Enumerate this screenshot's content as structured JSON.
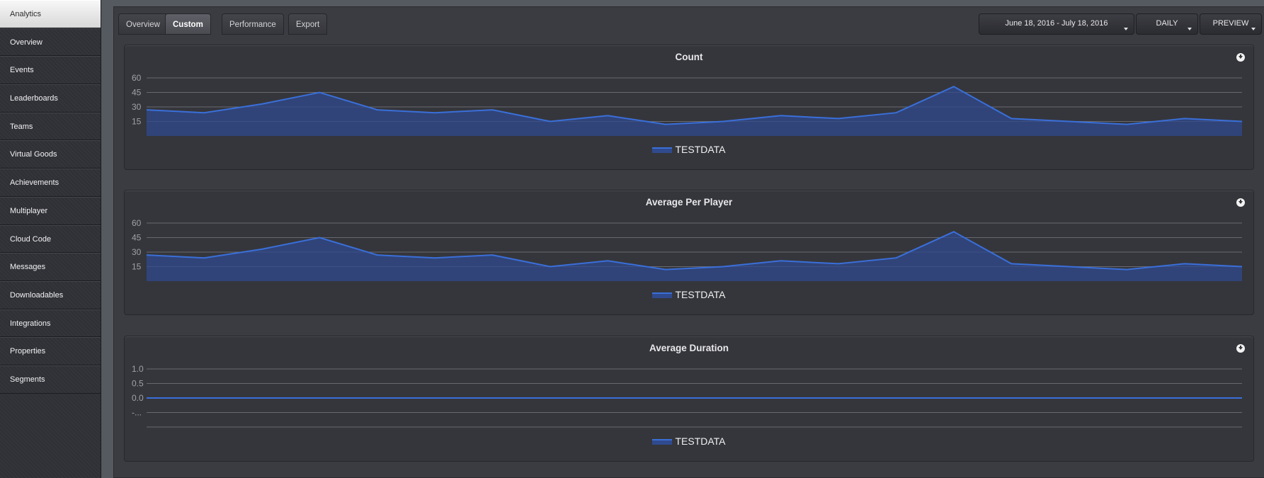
{
  "sidebar": {
    "items": [
      {
        "label": "Analytics",
        "active": true
      },
      {
        "label": "Overview"
      },
      {
        "label": "Events"
      },
      {
        "label": "Leaderboards"
      },
      {
        "label": "Teams"
      },
      {
        "label": "Virtual Goods"
      },
      {
        "label": "Achievements"
      },
      {
        "label": "Multiplayer"
      },
      {
        "label": "Cloud Code"
      },
      {
        "label": "Messages"
      },
      {
        "label": "Downloadables"
      },
      {
        "label": "Integrations"
      },
      {
        "label": "Properties"
      },
      {
        "label": "Segments"
      }
    ]
  },
  "tabs": [
    {
      "label": "Overview"
    },
    {
      "label": "Custom",
      "active": true
    },
    {
      "label": "Performance"
    },
    {
      "label": "Export"
    }
  ],
  "controls": {
    "date_range": "June 18, 2016 - July 18, 2016",
    "interval": "DAILY",
    "mode": "PREVIEW"
  },
  "colors": {
    "series_line": "#3a6fd9",
    "series_fill": "#2f4a8e",
    "grid": "#8a8b90",
    "tick_text": "#a0a1a6"
  },
  "chart_data": [
    {
      "type": "area",
      "title": "Count",
      "y_ticks": [
        "60",
        "45",
        "30",
        "15"
      ],
      "ylim": [
        0,
        60
      ],
      "series": [
        {
          "name": "TESTDATA",
          "values": [
            27,
            24,
            33,
            45,
            27,
            24,
            27,
            15,
            21,
            12,
            15,
            21,
            18,
            24,
            51,
            18,
            15,
            12,
            18,
            15
          ]
        }
      ]
    },
    {
      "type": "area",
      "title": "Average Per Player",
      "y_ticks": [
        "60",
        "45",
        "30",
        "15"
      ],
      "ylim": [
        0,
        60
      ],
      "series": [
        {
          "name": "TESTDATA",
          "values": [
            27,
            24,
            33,
            45,
            27,
            24,
            27,
            15,
            21,
            12,
            15,
            21,
            18,
            24,
            51,
            18,
            15,
            12,
            18,
            15
          ]
        }
      ]
    },
    {
      "type": "line",
      "title": "Average Duration",
      "y_ticks": [
        "1.0",
        "0.5",
        "0.0",
        "-..."
      ],
      "ylim": [
        -1,
        1
      ],
      "series": [
        {
          "name": "TESTDATA",
          "values": [
            0,
            0,
            0,
            0,
            0,
            0,
            0,
            0,
            0,
            0,
            0,
            0,
            0,
            0,
            0,
            0,
            0,
            0,
            0,
            0
          ]
        }
      ]
    }
  ]
}
